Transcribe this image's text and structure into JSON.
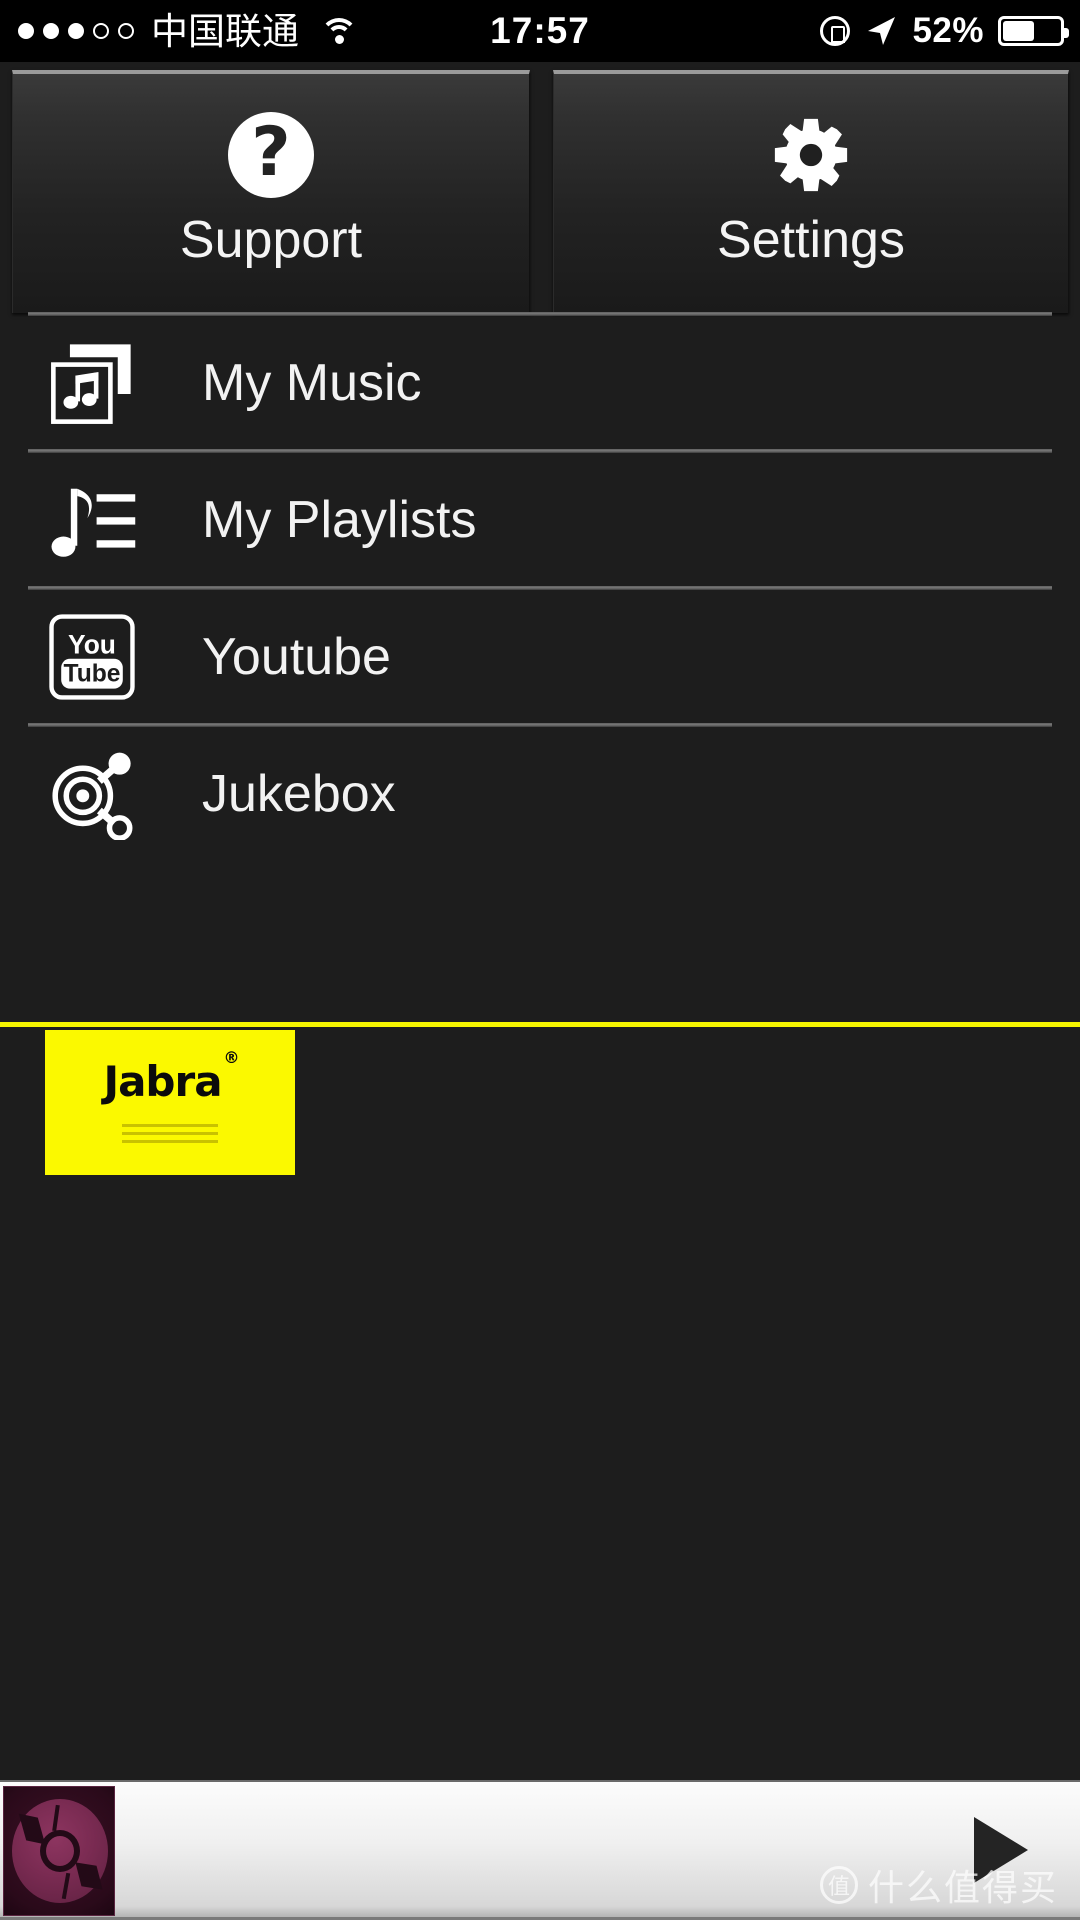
{
  "statusbar": {
    "carrier": "中国联通",
    "signal_dots_filled": 3,
    "signal_dots_total": 5,
    "wifi_icon": "wifi-icon",
    "time": "17:57",
    "rotation_lock_icon": "rotation-lock-icon",
    "location_icon": "location-arrow-icon",
    "battery_percent": "52%",
    "battery_level": 52
  },
  "tiles": [
    {
      "label": "Support",
      "icon": "question-mark-circle-icon",
      "glyph": "?"
    },
    {
      "label": "Settings",
      "icon": "gear-icon"
    }
  ],
  "menu": [
    {
      "label": "My Music",
      "icon": "music-albums-icon"
    },
    {
      "label": "My Playlists",
      "icon": "playlist-note-lines-icon"
    },
    {
      "label": "Youtube",
      "icon": "youtube-icon",
      "you": "You",
      "tube": "Tube"
    },
    {
      "label": "Jukebox",
      "icon": "jukebox-share-target-icon"
    }
  ],
  "ad": {
    "brand": "Jabra",
    "registered_mark": "®",
    "background_color": "#fbf900",
    "accent_line_color": "#f5f500",
    "text_color": "#0b0b0b"
  },
  "player": {
    "album_art": "album-art-disc-icon",
    "track_title": "",
    "play_button_icon": "play-icon",
    "state": "paused"
  },
  "watermark": {
    "badge": "值",
    "text": "什么值得买"
  },
  "theme": {
    "background": "#1d1d1d",
    "tile_top_border": "#9b9b9b",
    "separator": "#777777",
    "text": "#f2f2f2",
    "accent_yellow": "#fbf900"
  }
}
